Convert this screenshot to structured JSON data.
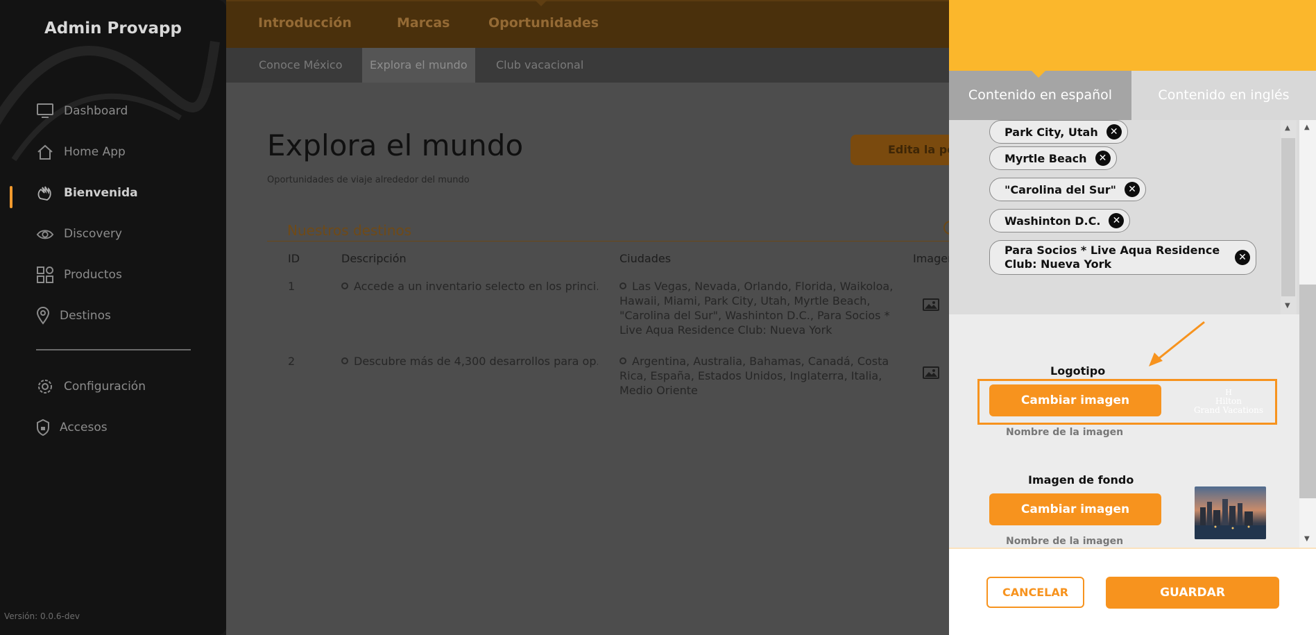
{
  "sidebar": {
    "brand": "Admin Provapp",
    "items": [
      {
        "label": "Dashboard",
        "icon": "monitor-icon"
      },
      {
        "label": "Home App",
        "icon": "home-icon"
      },
      {
        "label": "Bienvenida",
        "icon": "wave-hand-icon",
        "active": true
      },
      {
        "label": "Discovery",
        "icon": "eye-icon"
      },
      {
        "label": "Productos",
        "icon": "grid-icon"
      },
      {
        "label": "Destinos",
        "icon": "map-pin-icon"
      }
    ],
    "secondary": [
      {
        "label": "Configuración",
        "icon": "gear-icon"
      },
      {
        "label": "Accesos",
        "icon": "shield-lock-icon"
      }
    ],
    "version": "Versión: 0.0.6-dev"
  },
  "topnav": {
    "items": [
      "Introducción",
      "Marcas",
      "Oportunidades"
    ],
    "active": "Oportunidades"
  },
  "subnav": {
    "items": [
      "Conoce México",
      "Explora el mundo",
      "Club vacacional"
    ],
    "active": "Explora el mundo"
  },
  "main": {
    "title": "Explora el mundo",
    "subtitle": "Oportunidades de viaje alrededor del mundo",
    "edit_button": "Edita la po",
    "section_title": "Nuestros destinos",
    "table": {
      "headers": [
        "ID",
        "Descripción",
        "Ciudades",
        "Imagen"
      ],
      "rows": [
        {
          "id": "1",
          "description": "Accede a un inventario selecto en los princi…",
          "cities": [
            "Las Vegas, Nevada, Orlando, Florida, Waikoloa,",
            "Hawaii, Miami, Park City, Utah, Myrtle Beach,",
            "\"Carolina del Sur\", Washinton D.C., Para Socios *",
            "Live Aqua Residence Club: Nueva York"
          ]
        },
        {
          "id": "2",
          "description": "Descubre más de 4,300 desarrollos para op…",
          "cities": [
            "Argentina, Australia, Bahamas, Canadá, Costa",
            "Rica, España, Estados Unidos, Inglaterra, Italia,",
            "Medio Oriente"
          ]
        }
      ]
    }
  },
  "panel": {
    "tabs": [
      "Contenido en español",
      "Contenido en inglés"
    ],
    "active_tab": "Contenido en español",
    "tags": [
      "Park City, Utah",
      "Myrtle Beach",
      "\"Carolina del Sur\"",
      "Washinton D.C."
    ],
    "tag_multi": [
      "Para Socios * Live Aqua Residence",
      "Club: Nueva York"
    ],
    "tag_remove_glyph": "✕",
    "logo": {
      "label": "Logotipo",
      "button": "Cambiar imagen",
      "name_label": "Nombre de la imagen",
      "preview_lines": [
        "H",
        "Hilton",
        "Grand Vacations"
      ]
    },
    "background": {
      "label": "Imagen de fondo",
      "button": "Cambiar imagen",
      "name_label": "Nombre de la imagen"
    },
    "cancel": "CANCELAR",
    "save": "GUARDAR"
  },
  "colors": {
    "accent": "#f7931e",
    "header_yellow": "#fbb72c",
    "sidebar_bg": "#131313"
  }
}
